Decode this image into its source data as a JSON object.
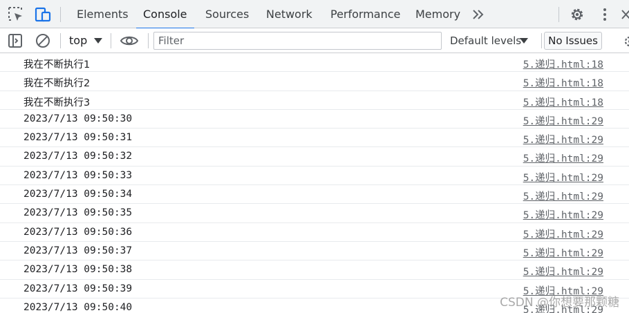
{
  "tabs": [
    {
      "label": "Elements"
    },
    {
      "label": "Console"
    },
    {
      "label": "Sources"
    },
    {
      "label": "Network"
    },
    {
      "label": "Performance"
    },
    {
      "label": "Memory"
    }
  ],
  "active_tab": "Console",
  "toolbar": {
    "context": "top",
    "filter_placeholder": "Filter",
    "filter_value": "",
    "levels": "Default levels",
    "issues": "No Issues"
  },
  "colors": {
    "accent": "#1a73e8",
    "icon": "#5f6368",
    "link": "#5f6368"
  },
  "icons": [
    "inspect-element-icon",
    "device-toolbar-icon",
    "more-tabs-icon",
    "gear-icon",
    "kebab-menu-icon",
    "close-icon",
    "sidebar-toggle-icon",
    "clear-console-icon",
    "caret-down-icon",
    "eye-icon"
  ],
  "messages": [
    {
      "text": "我在不断执行1",
      "source": "5.递归.html:18"
    },
    {
      "text": "我在不断执行2",
      "source": "5.递归.html:18"
    },
    {
      "text": "我在不断执行3",
      "source": "5.递归.html:18"
    },
    {
      "text": "2023/7/13 09:50:30",
      "source": "5.递归.html:29"
    },
    {
      "text": "2023/7/13 09:50:31",
      "source": "5.递归.html:29"
    },
    {
      "text": "2023/7/13 09:50:32",
      "source": "5.递归.html:29"
    },
    {
      "text": "2023/7/13 09:50:33",
      "source": "5.递归.html:29"
    },
    {
      "text": "2023/7/13 09:50:34",
      "source": "5.递归.html:29"
    },
    {
      "text": "2023/7/13 09:50:35",
      "source": "5.递归.html:29"
    },
    {
      "text": "2023/7/13 09:50:36",
      "source": "5.递归.html:29"
    },
    {
      "text": "2023/7/13 09:50:37",
      "source": "5.递归.html:29"
    },
    {
      "text": "2023/7/13 09:50:38",
      "source": "5.递归.html:29"
    },
    {
      "text": "2023/7/13 09:50:39",
      "source": "5.递归.html:29"
    },
    {
      "text": "2023/7/13 09:50:40",
      "source": "5.递归.html:29"
    }
  ],
  "watermark": "CSDN @你想要那颗糖"
}
